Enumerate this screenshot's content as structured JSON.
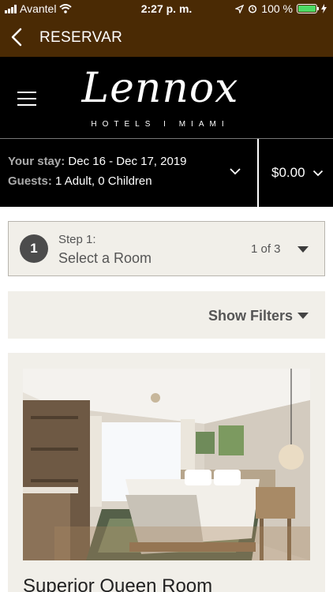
{
  "status_bar": {
    "carrier": "Avantel",
    "time": "2:27 p. m.",
    "battery": "100 %"
  },
  "nav": {
    "title": "RESERVAR",
    "back_icon": "chevron-left-icon"
  },
  "brand": {
    "logo_script": "Lennox",
    "logo_sub": "HOTELS I MIAMI",
    "menu_icon": "hamburger-menu-icon"
  },
  "stay": {
    "stay_label": "Your stay:",
    "stay_value": "Dec 16 - Dec 17, 2019",
    "guests_label": "Guests:",
    "guests_value": "1 Adult, 0 Children",
    "price": "$0.00"
  },
  "step": {
    "number": "1",
    "kicker": "Step 1:",
    "title": "Select a Room",
    "count": "1 of 3"
  },
  "filters": {
    "label": "Show Filters"
  },
  "room": {
    "name": "Superior Queen Room"
  },
  "colors": {
    "header_brown": "#4a2a04",
    "brand_black": "#000000",
    "card_bg": "#f1efe9",
    "battery_green": "#4cd964"
  }
}
